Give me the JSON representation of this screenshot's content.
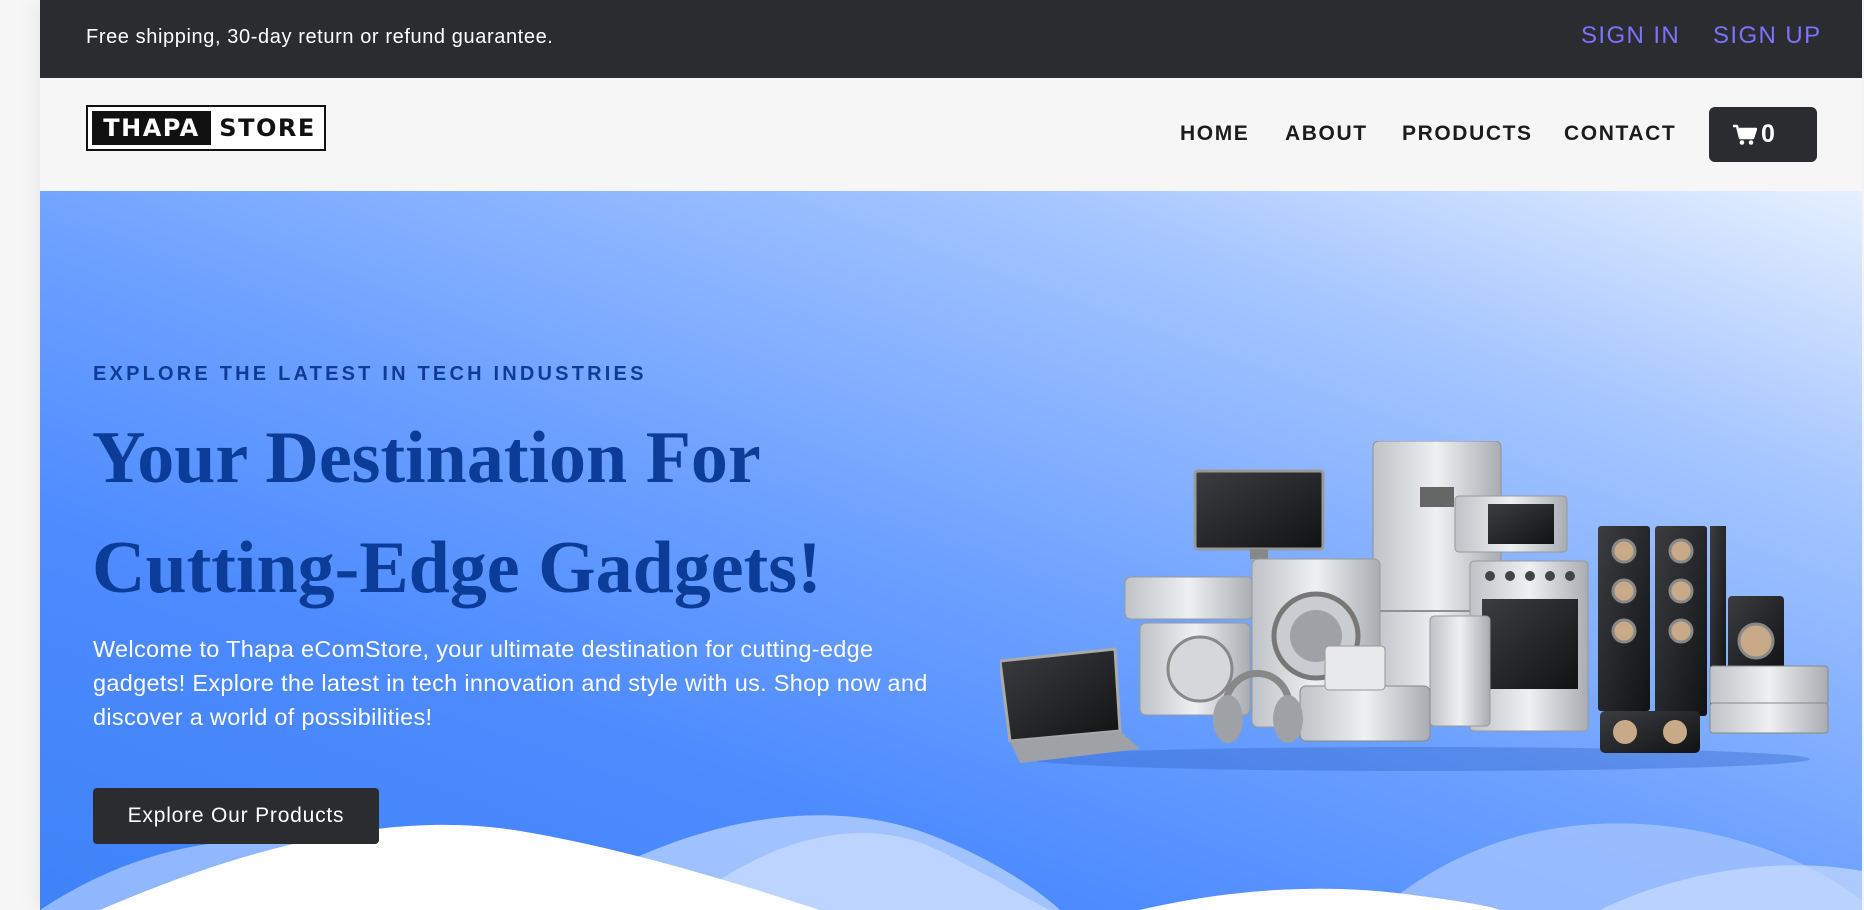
{
  "topbar": {
    "announcement": "Free shipping, 30-day return or refund guarantee.",
    "sign_in": "SIGN IN",
    "sign_up": "SIGN UP"
  },
  "header": {
    "logo": {
      "dark_part": "THAPA",
      "light_part": "STORE"
    },
    "nav": {
      "home": "HOME",
      "about": "ABOUT",
      "products": "PRODUCTS",
      "contact": "CONTACT"
    },
    "cart": {
      "icon": "cart-icon",
      "count": "0"
    }
  },
  "hero": {
    "kicker": "EXPLORE THE LATEST IN TECH INDUSTRIES",
    "title_line1": "Your Destination For",
    "title_line2": "Cutting-Edge Gadgets!",
    "description": "Welcome to Thapa eComStore, your ultimate destination for cutting-edge gadgets! Explore the latest in tech innovation and style with us. Shop now and discover a world of possibilities!",
    "cta_label": "Explore Our Products"
  },
  "colors": {
    "dark": "#2b2c30",
    "accent_link": "#7b72ff",
    "hero_heading": "#0b3c98",
    "hero_blue": "#4d8bff"
  }
}
